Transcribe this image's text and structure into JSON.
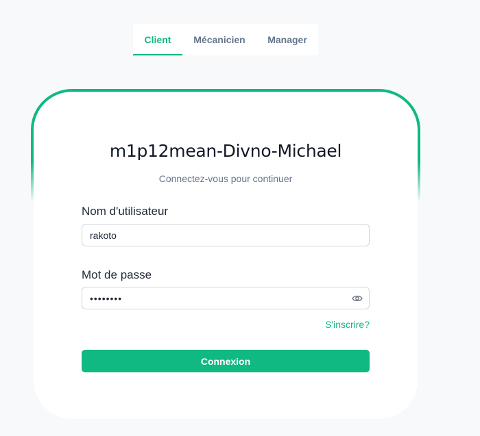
{
  "tabs": [
    {
      "label": "Client",
      "active": true
    },
    {
      "label": "Mécanicien",
      "active": false
    },
    {
      "label": "Manager",
      "active": false
    }
  ],
  "card": {
    "title": "m1p12mean-Divno-Michael",
    "subtitle": "Connectez-vous pour continuer"
  },
  "form": {
    "username_label": "Nom d'utilisateur",
    "username_value": "rakoto",
    "password_label": "Mot de passe",
    "password_value": "rakoto12",
    "password_icon": "eye-icon",
    "signup_link": "S'inscrire?",
    "submit_label": "Connexion"
  },
  "colors": {
    "accent": "#10b981",
    "text_muted": "#64748b",
    "background": "#f8f9fa"
  }
}
